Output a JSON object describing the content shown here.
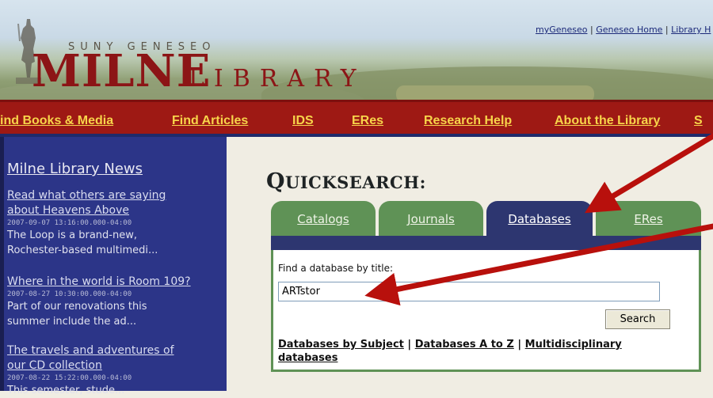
{
  "header": {
    "logo_suny": "SUNY GENESEO",
    "logo_milne": "MILNE",
    "logo_library": "LIBRARY",
    "toplinks": [
      "myGeneseo",
      "Geneseo Home",
      "Library H"
    ],
    "toplink_sep": " | "
  },
  "nav": [
    "ind Books & Media",
    "Find Articles",
    "IDS",
    "ERes",
    "Research Help",
    "About the Library",
    "S"
  ],
  "sidebar": {
    "title": "Milne Library News",
    "items": [
      {
        "link_line1": "Read what others are saying",
        "link_line2": "about Heavens Above",
        "date": "2007-09-07 13:16:00.000-04:00",
        "snippet_line1": "The Loop is a brand-new,",
        "snippet_line2": "Rochester-based multimedi..."
      },
      {
        "link_line1": "Where in the world is Room 109?",
        "date": "2007-08-27 10:30:00.000-04:00",
        "snippet_line1": "Part of our renovations this",
        "snippet_line2": "summer include the ad..."
      },
      {
        "link_line1": "The travels and adventures of",
        "link_line2": "our CD collection",
        "date": "2007-08-22 15:22:00.000-04:00",
        "snippet_line1": "This semester, stude..."
      }
    ]
  },
  "quicksearch": {
    "title_big": "Q",
    "title_rest": "UICKSEARCH:",
    "tabs": [
      "Catalogs",
      "Journals",
      "Databases",
      "ERes"
    ],
    "active_tab": "Databases",
    "label": "Find a database by title:",
    "input_value": "ARTstor",
    "search_button": "Search",
    "links": [
      "Databases by Subject",
      "Databases A to Z",
      "Multidisciplinary databases"
    ],
    "link_sep": " | "
  },
  "colors": {
    "nav_bg": "#9e1914",
    "nav_text": "#f7d44a",
    "sidebar_bg": "#2c3588",
    "tab_green": "#5f9256",
    "tab_active": "#2d3670",
    "arrow": "#b8100c"
  }
}
